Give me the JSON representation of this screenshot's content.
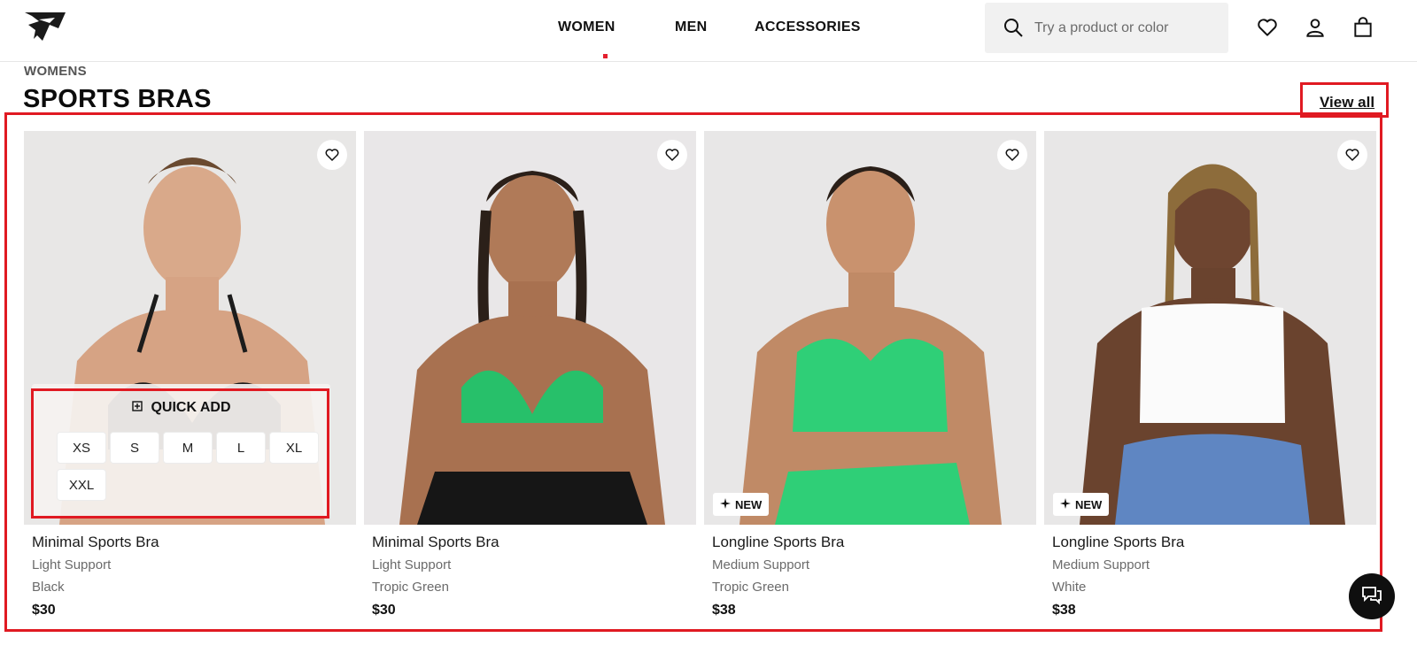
{
  "header": {
    "nav": [
      "WOMEN",
      "MEN",
      "ACCESSORIES"
    ],
    "search_placeholder": "Try a product or color",
    "active_nav": "WOMEN"
  },
  "breadcrumb": "WOMENS",
  "page_title": "SPORTS BRAS",
  "view_all": "View all",
  "quick_add": {
    "title": "QUICK ADD",
    "sizes": [
      "XS",
      "S",
      "M",
      "L",
      "XL",
      "XXL"
    ]
  },
  "badge_new": "NEW",
  "products": [
    {
      "name": "Minimal Sports Bra",
      "support": "Light Support",
      "color": "Black",
      "price": "$30",
      "is_new": false
    },
    {
      "name": "Minimal Sports Bra",
      "support": "Light Support",
      "color": "Tropic Green",
      "price": "$30",
      "is_new": false
    },
    {
      "name": "Longline Sports Bra",
      "support": "Medium Support",
      "color": "Tropic Green",
      "price": "$38",
      "is_new": true
    },
    {
      "name": "Longline Sports Bra",
      "support": "Medium Support",
      "color": "White",
      "price": "$38",
      "is_new": true
    }
  ],
  "colors": {
    "accent_red": "#e01a22",
    "text": "#111111",
    "muted": "#6b6b6b",
    "image_bg": "#e9e8e8"
  },
  "icons": [
    "logo-icon",
    "search-icon",
    "heart-icon",
    "account-icon",
    "bag-icon",
    "quick-add-icon",
    "sparkle-icon",
    "chat-icon"
  ]
}
